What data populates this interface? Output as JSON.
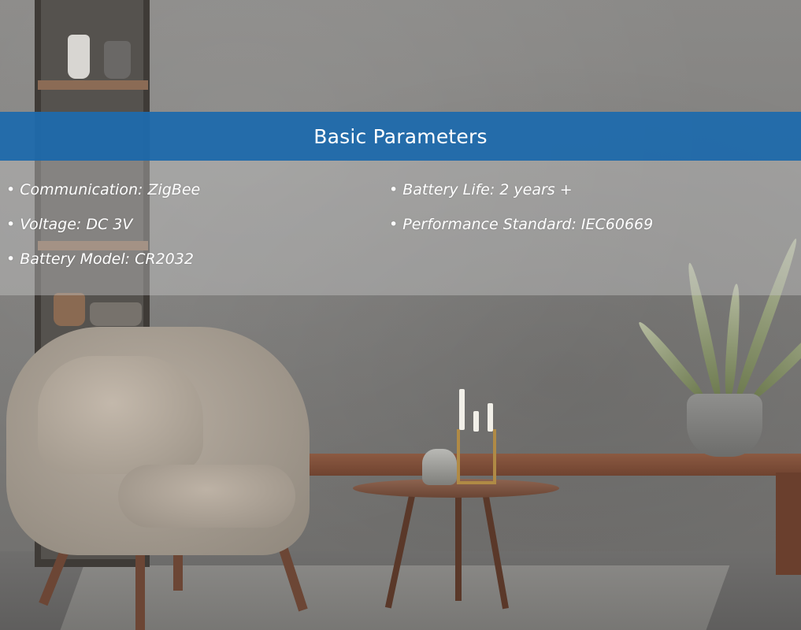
{
  "banner": {
    "title": "Basic Parameters"
  },
  "parameters": {
    "left": [
      "• Communication: ZigBee",
      "• Voltage: DC 3V",
      "• Battery Model: CR2032"
    ],
    "right": [
      "• Battery Life: 2 years +",
      "• Performance Standard: IEC60669"
    ]
  },
  "colors": {
    "banner": "#1967aa",
    "text": "#ffffff",
    "wall": "#7d7d7b"
  },
  "background_scene": {
    "icon": "living-room-photo"
  }
}
